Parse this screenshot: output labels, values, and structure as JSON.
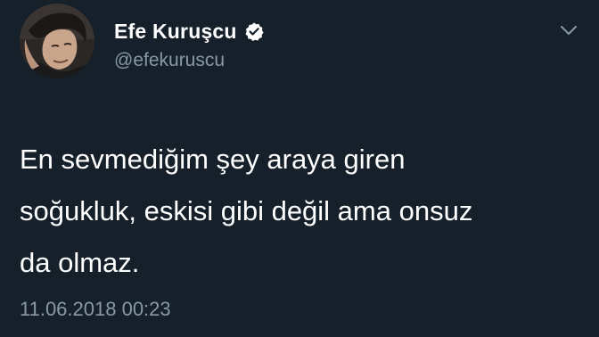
{
  "author": {
    "display_name": "Efe Kuruşcu",
    "handle": "@efekuruscu",
    "verified_icon": "verified-badge-icon",
    "avatar_icon": "profile-photo"
  },
  "menu": {
    "icon": "chevron-down-icon"
  },
  "tweet": {
    "lines": [
      "En sevmediğim şey araya giren",
      "soğukluk, eskisi gibi değil ama onsuz",
      "da olmaz."
    ],
    "timestamp": "11.06.2018 00:23"
  },
  "colors": {
    "background": "#15202b",
    "text": "#ffffff",
    "secondary_text": "#8899a6"
  }
}
